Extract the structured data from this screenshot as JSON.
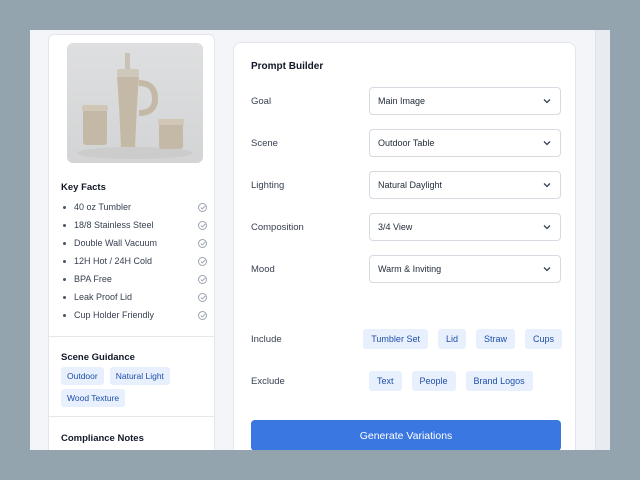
{
  "key_facts": {
    "title": "Key Facts",
    "items": [
      "40 oz Tumbler",
      "18/8 Stainless Steel",
      "Double Wall Vacuum",
      "12H Hot / 24H Cold",
      "BPA Free",
      "Leak Proof Lid",
      "Cup Holder Friendly"
    ]
  },
  "scene_guidance": {
    "title": "Scene Guidance",
    "tags": [
      "Outdoor",
      "Natural Light",
      "Wood Texture"
    ]
  },
  "compliance": {
    "title": "Compliance Notes"
  },
  "prompt_builder": {
    "title": "Prompt Builder",
    "goal": {
      "label": "Goal",
      "value": "Main Image"
    },
    "scene": {
      "label": "Scene",
      "value": "Outdoor Table"
    },
    "lighting": {
      "label": "Lighting",
      "value": "Natural Daylight"
    },
    "composition": {
      "label": "Composition",
      "value": "3/4 View"
    },
    "mood": {
      "label": "Mood",
      "value": "Warm & Inviting"
    },
    "include": {
      "label": "Include",
      "tags": [
        "Tumbler Set",
        "Lid",
        "Straw",
        "Cups"
      ]
    },
    "exclude": {
      "label": "Exclude",
      "tags": [
        "Text",
        "People",
        "Brand Logos"
      ]
    },
    "generate_label": "Generate Variations"
  },
  "colors": {
    "accent": "#3b77e0",
    "chip_bg": "#e8f0fe",
    "chip_text": "#1e4fa8",
    "backdrop": "#94a4af"
  }
}
